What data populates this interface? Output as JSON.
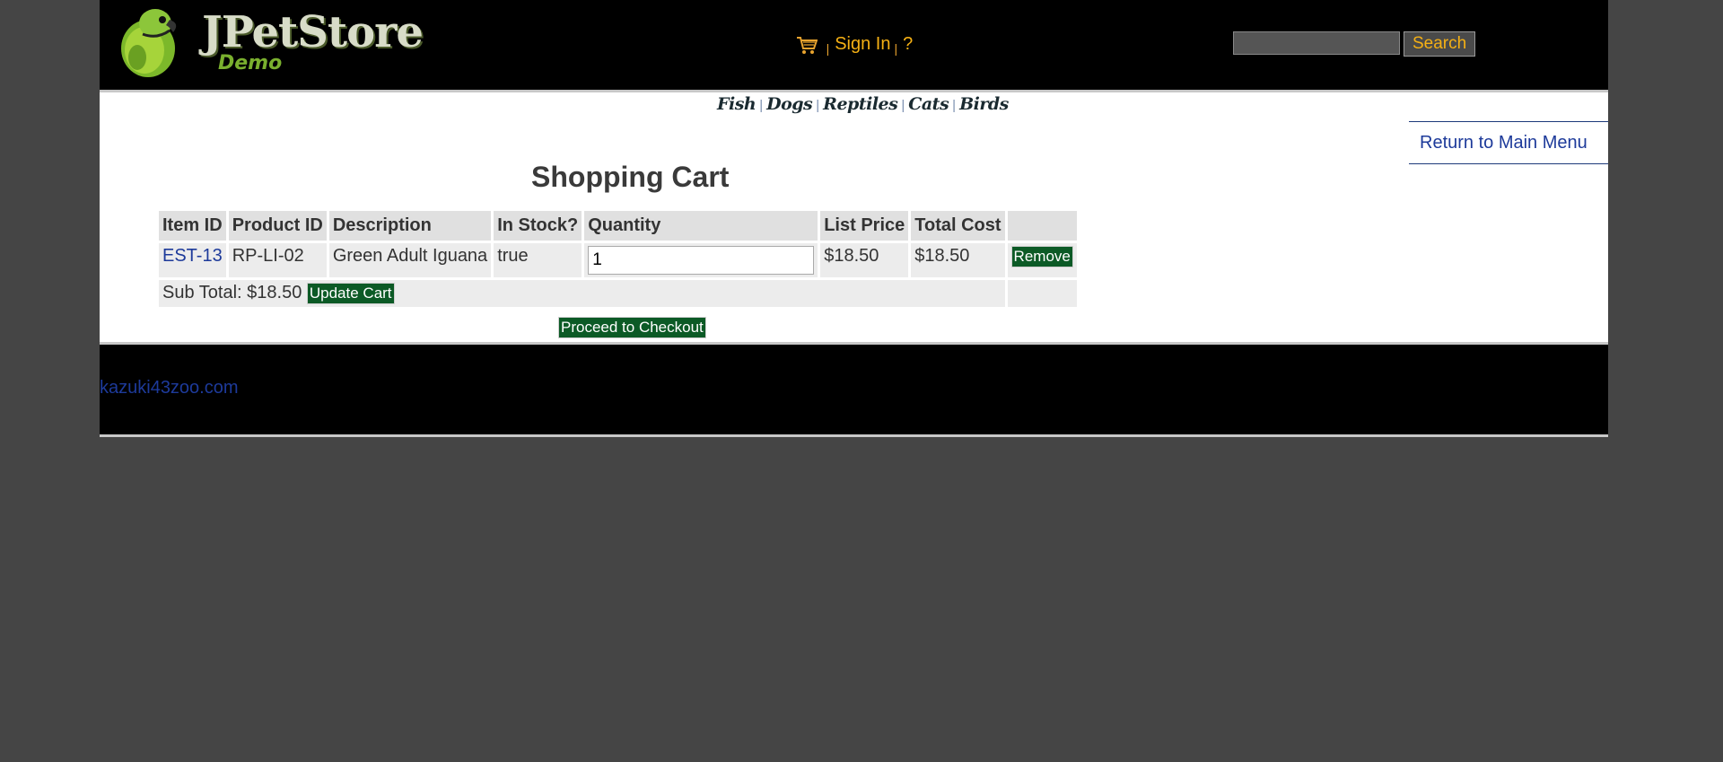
{
  "header": {
    "logo_text": "JPetStore",
    "logo_sub": "Demo",
    "sign_in": "Sign In",
    "help": "?",
    "separator": "|",
    "search_placeholder": "",
    "search_button": "Search"
  },
  "quicklinks": [
    "Fish",
    "Dogs",
    "Reptiles",
    "Cats",
    "Birds"
  ],
  "return_link": "Return to Main Menu",
  "cart": {
    "title": "Shopping Cart",
    "columns": [
      "Item ID",
      "Product ID",
      "Description",
      "In Stock?",
      "Quantity",
      "List Price",
      "Total Cost"
    ],
    "items": [
      {
        "item_id": "EST-13",
        "product_id": "RP-LI-02",
        "description": "Green Adult Iguana",
        "in_stock": "true",
        "quantity": "1",
        "list_price": "$18.50",
        "total_cost": "$18.50",
        "remove_label": "Remove"
      }
    ],
    "subtotal_label": "Sub Total: $18.50",
    "update_button": "Update Cart",
    "checkout_button": "Proceed to Checkout"
  },
  "footer": {
    "link": "kazuki43zoo.com"
  },
  "colors": {
    "page_bg": "#454545",
    "header_bg": "#000000",
    "accent": "#f5b014",
    "link": "#1d3a9a",
    "button_green": "#0c5a26"
  }
}
